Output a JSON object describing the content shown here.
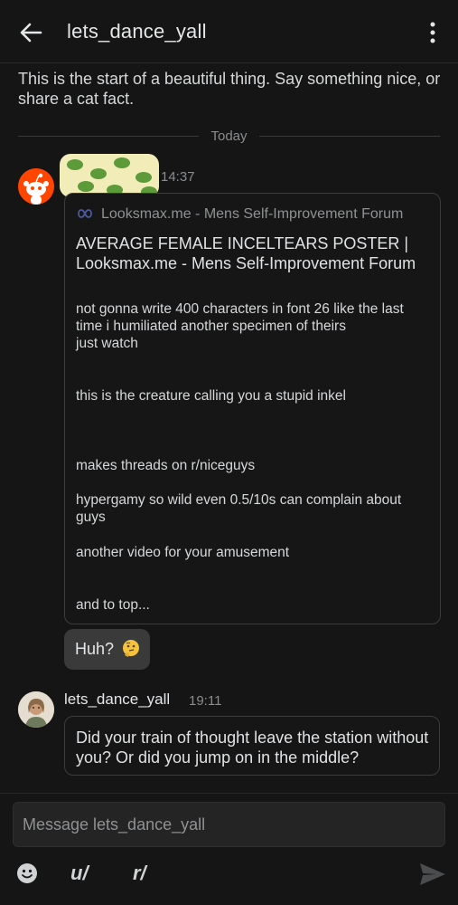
{
  "header": {
    "title": "lets_dance_yall"
  },
  "intro_text": "This is the start of a beautiful thing. Say something nice, or share a cat fact.",
  "divider_label": "Today",
  "messages": [
    {
      "time": "14:37",
      "link_preview": {
        "site": "Looksmax.me - Mens Self-Improvement Forum",
        "headline": "AVERAGE FEMALE INCELTEARS POSTER | Looksmax.me - Mens Self-Improvement Forum",
        "paragraphs": [
          "not gonna write 400 characters in font 26 like the last time i humiliated another specimen of theirs",
          "just watch",
          "this is the creature calling you a stupid inkel",
          "makes threads on r/niceguys",
          "hypergamy so wild even 0.5/10s can complain about guys",
          "another video for your amusement",
          "and to top..."
        ]
      },
      "followup": "Huh?"
    },
    {
      "author": "lets_dance_yall",
      "time": "19:11",
      "text": "Did your train of thought leave the station without you? Or did you jump on in the middle?"
    }
  ],
  "composer": {
    "placeholder": "Message lets_dance_yall",
    "user_button": "u/",
    "subreddit_button": "r/"
  },
  "colors": {
    "background": "#151515",
    "bubble": "#3a3a3a",
    "border": "#3c3c3c",
    "muted": "#8a8c8e",
    "reddit_orange": "#ff4500"
  },
  "icons": [
    "back-arrow-icon",
    "more-vertical-icon",
    "link-chain-icon",
    "thinking-face-emoji",
    "emoji-face-icon",
    "send-icon"
  ]
}
